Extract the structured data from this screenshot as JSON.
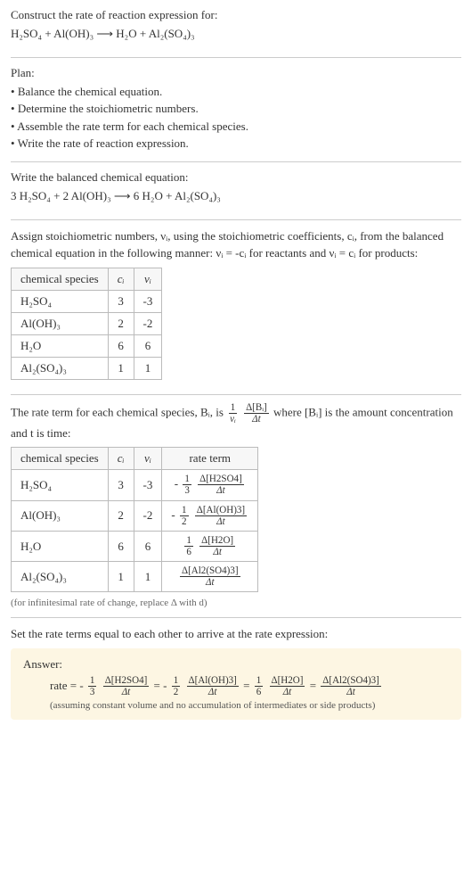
{
  "prompt": {
    "line1": "Construct the rate of reaction expression for:",
    "equation": "H₂SO₄ + Al(OH)₃  ⟶  H₂O + Al₂(SO₄)₃"
  },
  "plan": {
    "title": "Plan:",
    "items": [
      "Balance the chemical equation.",
      "Determine the stoichiometric numbers.",
      "Assemble the rate term for each chemical species.",
      "Write the rate of reaction expression."
    ]
  },
  "balanced": {
    "title": "Write the balanced chemical equation:",
    "equation": "3 H₂SO₄ + 2 Al(OH)₃  ⟶  6 H₂O + Al₂(SO₄)₃"
  },
  "stoich": {
    "intro": "Assign stoichiometric numbers, νᵢ, using the stoichiometric coefficients, cᵢ, from the balanced chemical equation in the following manner: νᵢ = -cᵢ for reactants and νᵢ = cᵢ for products:",
    "headers": {
      "species": "chemical species",
      "ci": "cᵢ",
      "vi": "νᵢ"
    },
    "rows": [
      {
        "species": "H₂SO₄",
        "ci": "3",
        "vi": "-3"
      },
      {
        "species": "Al(OH)₃",
        "ci": "2",
        "vi": "-2"
      },
      {
        "species": "H₂O",
        "ci": "6",
        "vi": "6"
      },
      {
        "species": "Al₂(SO₄)₃",
        "ci": "1",
        "vi": "1"
      }
    ]
  },
  "rateterm": {
    "intro_pre": "The rate term for each chemical species, Bᵢ, is ",
    "intro_post": " where [Bᵢ] is the amount concentration and t is time:",
    "frac_num": "1",
    "frac_den": "νᵢ",
    "frac2_num": "Δ[Bᵢ]",
    "frac2_den": "Δt",
    "headers": {
      "species": "chemical species",
      "ci": "cᵢ",
      "vi": "νᵢ",
      "rate": "rate term"
    },
    "rows": [
      {
        "species": "H₂SO₄",
        "ci": "3",
        "vi": "-3",
        "sign": "-",
        "coef_num": "1",
        "coef_den": "3",
        "conc_num": "Δ[H2SO4]",
        "conc_den": "Δt"
      },
      {
        "species": "Al(OH)₃",
        "ci": "2",
        "vi": "-2",
        "sign": "-",
        "coef_num": "1",
        "coef_den": "2",
        "conc_num": "Δ[Al(OH)3]",
        "conc_den": "Δt"
      },
      {
        "species": "H₂O",
        "ci": "6",
        "vi": "6",
        "sign": "",
        "coef_num": "1",
        "coef_den": "6",
        "conc_num": "Δ[H2O]",
        "conc_den": "Δt"
      },
      {
        "species": "Al₂(SO₄)₃",
        "ci": "1",
        "vi": "1",
        "sign": "",
        "coef_num": "",
        "coef_den": "",
        "conc_num": "Δ[Al2(SO4)3]",
        "conc_den": "Δt"
      }
    ],
    "note": "(for infinitesimal rate of change, replace Δ with d)"
  },
  "final": {
    "intro": "Set the rate terms equal to each other to arrive at the rate expression:",
    "answer_label": "Answer:",
    "rate_prefix": "rate = ",
    "terms": [
      {
        "sign": "-",
        "coef_num": "1",
        "coef_den": "3",
        "conc_num": "Δ[H2SO4]",
        "conc_den": "Δt"
      },
      {
        "sign": "-",
        "coef_num": "1",
        "coef_den": "2",
        "conc_num": "Δ[Al(OH)3]",
        "conc_den": "Δt"
      },
      {
        "sign": "",
        "coef_num": "1",
        "coef_den": "6",
        "conc_num": "Δ[H2O]",
        "conc_den": "Δt"
      },
      {
        "sign": "",
        "coef_num": "",
        "coef_den": "",
        "conc_num": "Δ[Al2(SO4)3]",
        "conc_den": "Δt"
      }
    ],
    "eq": " = ",
    "assume": "(assuming constant volume and no accumulation of intermediates or side products)"
  }
}
